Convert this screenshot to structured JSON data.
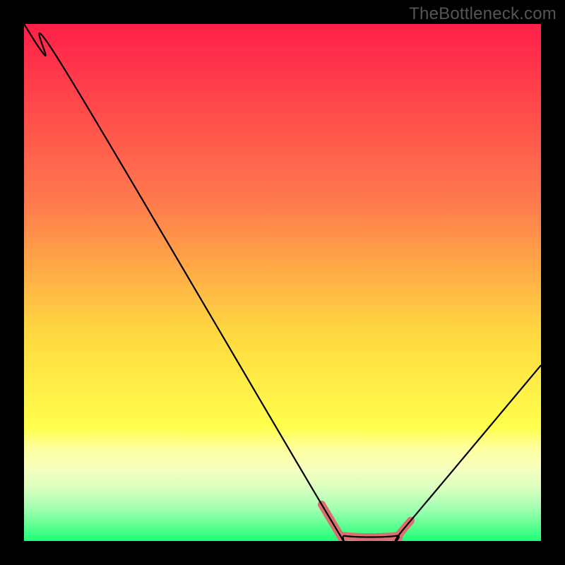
{
  "watermark": "TheBottleneck.com",
  "chart_data": {
    "type": "line",
    "title": "",
    "xlabel": "",
    "ylabel": "",
    "xlim": [
      0,
      100
    ],
    "ylim": [
      0,
      100
    ],
    "series": [
      {
        "name": "curve",
        "x": [
          0,
          4,
          8,
          60,
          62,
          72,
          74,
          100
        ],
        "values": [
          100,
          94,
          91,
          3,
          1,
          1,
          3,
          34
        ]
      }
    ],
    "annotations": [
      {
        "name": "highlight-segment",
        "x_range": [
          57,
          75
        ],
        "color": "#db6e6e"
      }
    ],
    "background": {
      "type": "vertical-gradient",
      "stops": [
        {
          "offset": 0.0,
          "color": "#ff1f49"
        },
        {
          "offset": 0.35,
          "color": "#ff7c4d"
        },
        {
          "offset": 0.6,
          "color": "#ffd940"
        },
        {
          "offset": 0.78,
          "color": "#ffff4d"
        },
        {
          "offset": 0.82,
          "color": "#ffff9d"
        },
        {
          "offset": 0.86,
          "color": "#f7ffbf"
        },
        {
          "offset": 0.9,
          "color": "#d7ffbf"
        },
        {
          "offset": 0.94,
          "color": "#9dffb0"
        },
        {
          "offset": 0.97,
          "color": "#5eff92"
        },
        {
          "offset": 1.0,
          "color": "#1cff78"
        }
      ]
    }
  }
}
